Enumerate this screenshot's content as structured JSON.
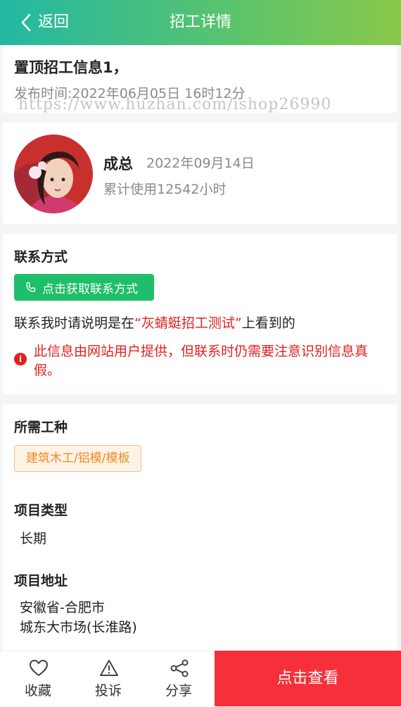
{
  "header": {
    "back_label": "返回",
    "title": "招工详情"
  },
  "post": {
    "title": "置顶招工信息1，",
    "publish_time": "发布时间:2022年06月05日 16时12分",
    "watermark": "https://www.huzhan.com/ishop26990"
  },
  "poster": {
    "name": "成总",
    "date": "2022年09月14日",
    "usage": "累计使用12542小时"
  },
  "contact": {
    "heading": "联系方式",
    "button_label": "点击获取联系方式",
    "note_prefix": "联系我时请说明是在",
    "note_highlight": "“灰蜻蜓招工测试”",
    "note_suffix": "上看到的",
    "warning": "此信息由网站用户提供，但联系时仍需要注意识别信息真假。"
  },
  "job": {
    "trade_heading": "所需工种",
    "trade_tag": "建筑木工/铝模/模板",
    "type_heading": "项目类型",
    "type_value": "长期",
    "address_heading": "项目地址",
    "address_line1": "安徽省-合肥市",
    "address_line2": "城东大市场(长淮路)"
  },
  "bottom_bar": {
    "favorite_label": "收藏",
    "report_label": "投诉",
    "share_label": "分享",
    "view_label": "点击查看"
  },
  "colors": {
    "header_start": "#22b8a4",
    "header_end": "#8ac84a",
    "contact_button": "#1fbe69",
    "warning": "#e02020",
    "view_button": "#f5303a",
    "tag_text": "#f08a1e"
  }
}
